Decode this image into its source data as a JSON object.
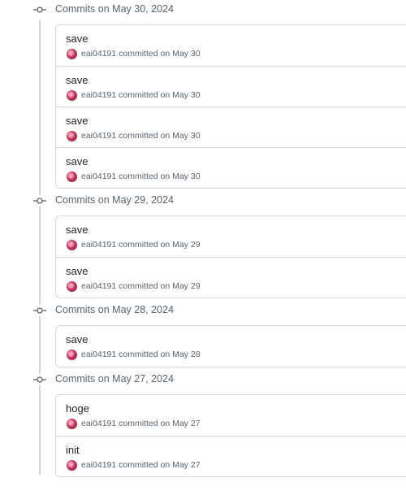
{
  "groups": [
    {
      "title": "Commits on May 30, 2024",
      "commits": [
        {
          "message": "save",
          "author": "eai04191",
          "action": "committed",
          "date": "on May 30"
        },
        {
          "message": "save",
          "author": "eai04191",
          "action": "committed",
          "date": "on May 30"
        },
        {
          "message": "save",
          "author": "eai04191",
          "action": "committed",
          "date": "on May 30"
        },
        {
          "message": "save",
          "author": "eai04191",
          "action": "committed",
          "date": "on May 30"
        }
      ]
    },
    {
      "title": "Commits on May 29, 2024",
      "commits": [
        {
          "message": "save",
          "author": "eai04191",
          "action": "committed",
          "date": "on May 29"
        },
        {
          "message": "save",
          "author": "eai04191",
          "action": "committed",
          "date": "on May 29"
        }
      ]
    },
    {
      "title": "Commits on May 28, 2024",
      "commits": [
        {
          "message": "save",
          "author": "eai04191",
          "action": "committed",
          "date": "on May 28"
        }
      ]
    },
    {
      "title": "Commits on May 27, 2024",
      "commits": [
        {
          "message": "hoge",
          "author": "eai04191",
          "action": "committed",
          "date": "on May 27"
        },
        {
          "message": "init",
          "author": "eai04191",
          "action": "committed",
          "date": "on May 27"
        }
      ]
    }
  ],
  "icons": {
    "group_marker": "git-commit-icon",
    "avatar": "user-avatar"
  },
  "colors": {
    "border": "#d0d7de",
    "muted_text": "#59636e",
    "text": "#1f2328",
    "avatar": "#c2335a"
  }
}
